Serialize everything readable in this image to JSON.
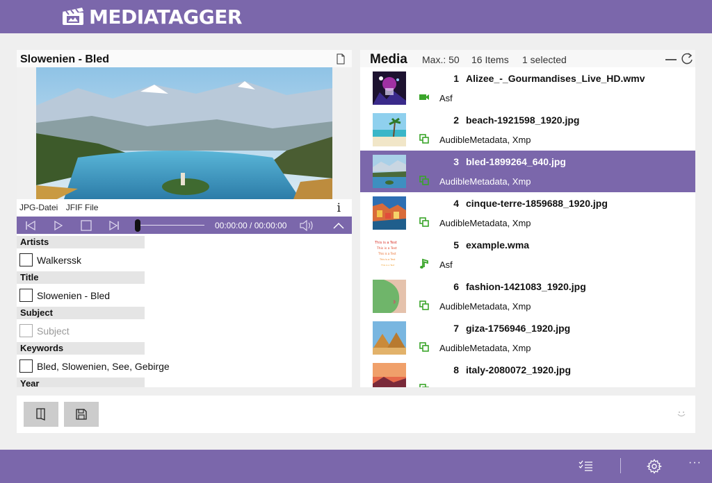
{
  "app": {
    "name": "MEDIATAGGER"
  },
  "preview": {
    "title": "Slowenien - Bled",
    "file_type": "JPG-Datei",
    "file_format": "JFIF File",
    "info_label": "i",
    "time": "00:00:00 / 00:00:00"
  },
  "fields": [
    {
      "label": "Artists",
      "value": "Walkerssk",
      "placeholder": false
    },
    {
      "label": "Title",
      "value": "Slowenien - Bled",
      "placeholder": false
    },
    {
      "label": "Subject",
      "value": "Subject",
      "placeholder": true
    },
    {
      "label": "Keywords",
      "value": "Bled, Slowenien, See, Gebirge",
      "placeholder": false
    },
    {
      "label": "Year",
      "value": "",
      "placeholder": false
    }
  ],
  "media": {
    "title": "Media",
    "max": "Max.: 50",
    "count": "16 Items",
    "selected": "1 selected",
    "items": [
      {
        "num": "1",
        "name": "Alizee_-_Gourmandises_Live_HD.wmv",
        "meta": "Asf",
        "type": "video-icon",
        "selected": false
      },
      {
        "num": "2",
        "name": "beach-1921598_1920.jpg",
        "meta": "AudibleMetadata, Xmp",
        "type": "image-icon",
        "selected": false
      },
      {
        "num": "3",
        "name": "bled-1899264_640.jpg",
        "meta": "AudibleMetadata, Xmp",
        "type": "image-icon",
        "selected": true
      },
      {
        "num": "4",
        "name": "cinque-terre-1859688_1920.jpg",
        "meta": "AudibleMetadata, Xmp",
        "type": "image-icon",
        "selected": false
      },
      {
        "num": "5",
        "name": "example.wma",
        "meta": "Asf",
        "type": "music-icon",
        "selected": false
      },
      {
        "num": "6",
        "name": "fashion-1421083_1920.jpg",
        "meta": "AudibleMetadata, Xmp",
        "type": "image-icon",
        "selected": false
      },
      {
        "num": "7",
        "name": "giza-1756946_1920.jpg",
        "meta": "AudibleMetadata, Xmp",
        "type": "image-icon",
        "selected": false
      },
      {
        "num": "8",
        "name": "italy-2080072_1920.jpg",
        "meta": "",
        "type": "image-icon",
        "selected": false
      }
    ]
  },
  "thumb_text": [
    "This is a Test",
    "This is a Test",
    "This is a Test",
    "This is a Test",
    "This is a Test"
  ],
  "colors": {
    "accent": "#7b67ab",
    "icon_green": "#3aa52a"
  }
}
